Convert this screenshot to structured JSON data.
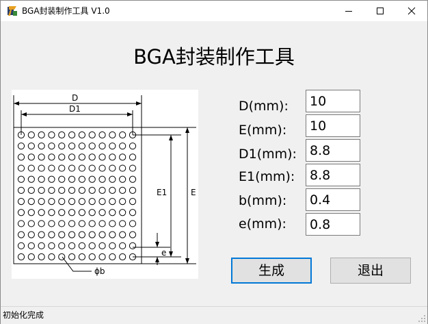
{
  "window": {
    "title": "BGA封装制作工具 V1.0",
    "controls": [
      "minimize",
      "maximize",
      "close"
    ]
  },
  "heading": "BGA封装制作工具",
  "diagram": {
    "labels": {
      "D": "D",
      "D1": "D1",
      "E": "E",
      "E1": "E1",
      "e": "e",
      "b": "ϕb"
    }
  },
  "form": {
    "fields": [
      {
        "label": "D(mm):",
        "value": "10"
      },
      {
        "label": "E(mm):",
        "value": "10"
      },
      {
        "label": "D1(mm):",
        "value": "8.8"
      },
      {
        "label": "E1(mm):",
        "value": "8.8"
      },
      {
        "label": "b(mm):",
        "value": "0.4"
      },
      {
        "label": "e(mm):",
        "value": "0.8"
      }
    ]
  },
  "buttons": {
    "generate": "生成",
    "exit": "退出"
  },
  "status": "初始化完成",
  "colors": {
    "window_bg": "#f0f0f0",
    "titlebar_bg": "#ffffff",
    "accent": "#0078d7",
    "button_bg": "#e1e1e1"
  }
}
